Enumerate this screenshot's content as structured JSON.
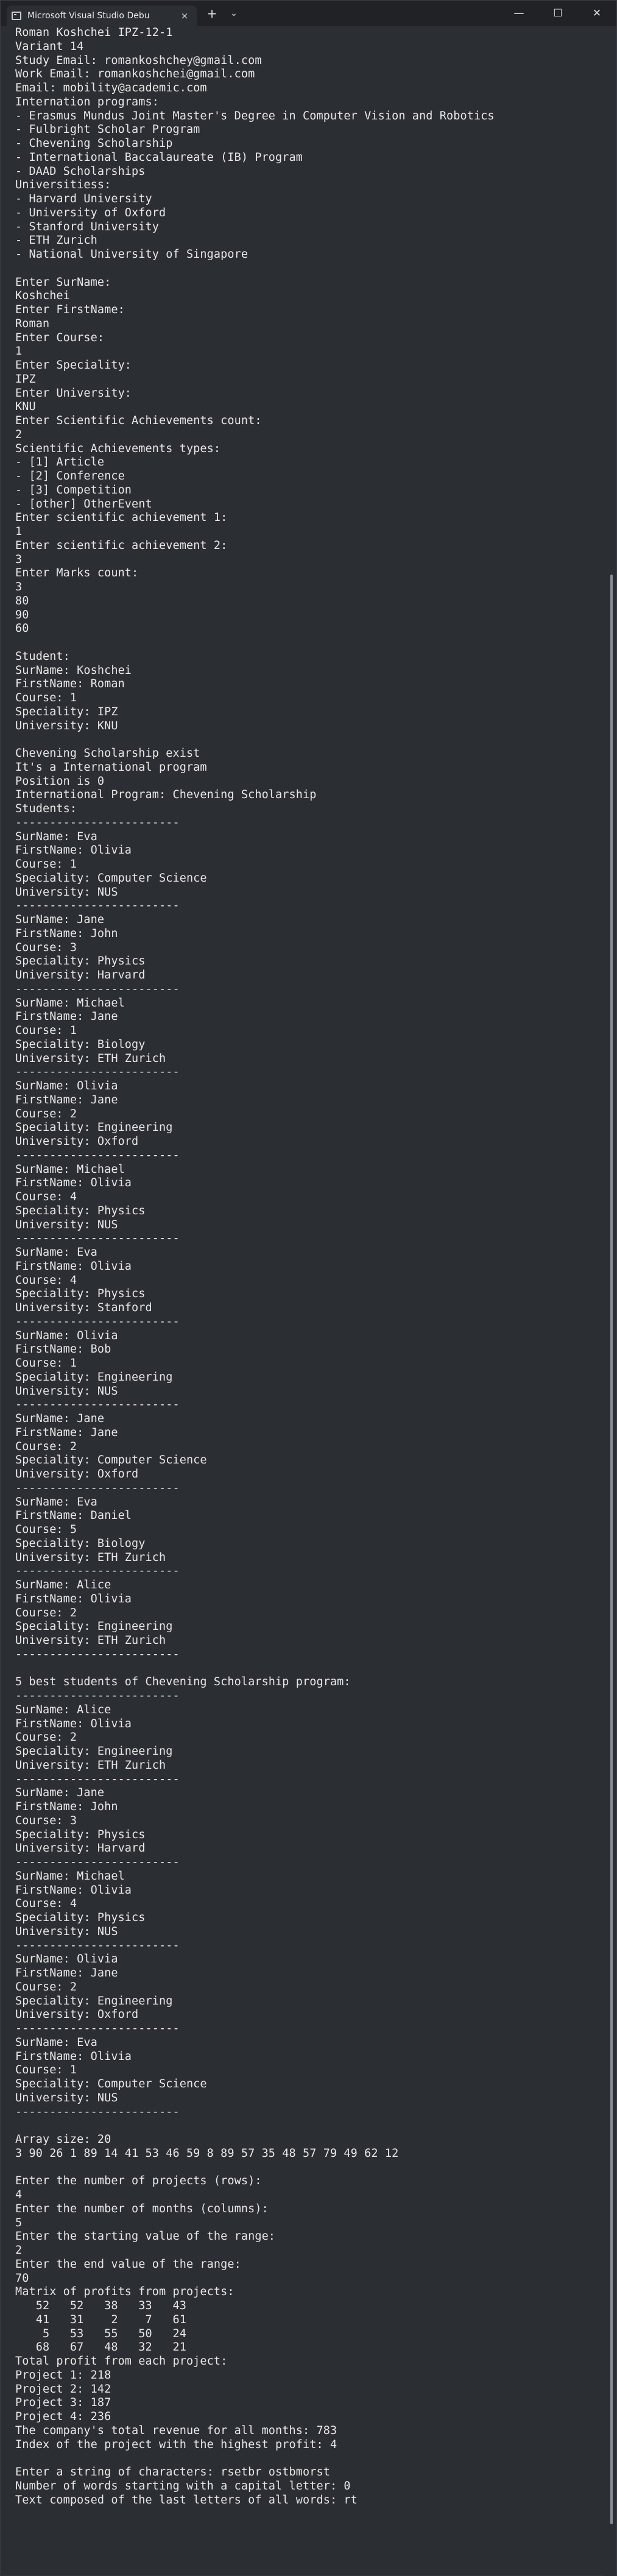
{
  "window": {
    "tab_title": "Microsoft Visual Studio Debu",
    "close_tab_glyph": "×",
    "new_tab_glyph": "+",
    "dropdown_glyph": "⌄",
    "minimize_glyph": "—",
    "maximize_glyph": "☐",
    "close_glyph": "✕"
  },
  "console_lines": [
    "Roman Koshchei IPZ-12-1",
    "Variant 14",
    "Study Email: romankoshchey@gmail.com",
    "Work Email: romankoshchei@gmail.com",
    "Email: mobility@academic.com",
    "Internation programs:",
    "- Erasmus Mundus Joint Master's Degree in Computer Vision and Robotics",
    "- Fulbright Scholar Program",
    "- Chevening Scholarship",
    "- International Baccalaureate (IB) Program",
    "- DAAD Scholarships",
    "Universitiess:",
    "- Harvard University",
    "- University of Oxford",
    "- Stanford University",
    "- ETH Zurich",
    "- National University of Singapore",
    "",
    "Enter SurName:",
    "Koshchei",
    "Enter FirstName:",
    "Roman",
    "Enter Course:",
    "1",
    "Enter Speciality:",
    "IPZ",
    "Enter University:",
    "KNU",
    "Enter Scientific Achievements count:",
    "2",
    "Scientific Achievements types:",
    "- [1] Article",
    "- [2] Conference",
    "- [3] Competition",
    "- [other] OtherEvent",
    "Enter scientific achievement 1:",
    "1",
    "Enter scientific achievement 2:",
    "3",
    "Enter Marks count:",
    "3",
    "80",
    "90",
    "60",
    "",
    "Student:",
    "SurName: Koshchei",
    "FirstName: Roman",
    "Course: 1",
    "Speciality: IPZ",
    "University: KNU",
    "",
    "Chevening Scholarship exist",
    "It's a International program",
    "Position is 0",
    "International Program: Chevening Scholarship",
    "Students:",
    "------------------------",
    "SurName: Eva",
    "FirstName: Olivia",
    "Course: 1",
    "Speciality: Computer Science",
    "University: NUS",
    "------------------------",
    "SurName: Jane",
    "FirstName: John",
    "Course: 3",
    "Speciality: Physics",
    "University: Harvard",
    "------------------------",
    "SurName: Michael",
    "FirstName: Jane",
    "Course: 1",
    "Speciality: Biology",
    "University: ETH Zurich",
    "------------------------",
    "SurName: Olivia",
    "FirstName: Jane",
    "Course: 2",
    "Speciality: Engineering",
    "University: Oxford",
    "------------------------",
    "SurName: Michael",
    "FirstName: Olivia",
    "Course: 4",
    "Speciality: Physics",
    "University: NUS",
    "------------------------",
    "SurName: Eva",
    "FirstName: Olivia",
    "Course: 4",
    "Speciality: Physics",
    "University: Stanford",
    "------------------------",
    "SurName: Olivia",
    "FirstName: Bob",
    "Course: 1",
    "Speciality: Engineering",
    "University: NUS",
    "------------------------",
    "SurName: Jane",
    "FirstName: Jane",
    "Course: 2",
    "Speciality: Computer Science",
    "University: Oxford",
    "------------------------",
    "SurName: Eva",
    "FirstName: Daniel",
    "Course: 5",
    "Speciality: Biology",
    "University: ETH Zurich",
    "------------------------",
    "SurName: Alice",
    "FirstName: Olivia",
    "Course: 2",
    "Speciality: Engineering",
    "University: ETH Zurich",
    "------------------------",
    "",
    "5 best students of Chevening Scholarship program:",
    "------------------------",
    "SurName: Alice",
    "FirstName: Olivia",
    "Course: 2",
    "Speciality: Engineering",
    "University: ETH Zurich",
    "------------------------",
    "SurName: Jane",
    "FirstName: John",
    "Course: 3",
    "Speciality: Physics",
    "University: Harvard",
    "------------------------",
    "SurName: Michael",
    "FirstName: Olivia",
    "Course: 4",
    "Speciality: Physics",
    "University: NUS",
    "------------------------",
    "SurName: Olivia",
    "FirstName: Jane",
    "Course: 2",
    "Speciality: Engineering",
    "University: Oxford",
    "------------------------",
    "SurName: Eva",
    "FirstName: Olivia",
    "Course: 1",
    "Speciality: Computer Science",
    "University: NUS",
    "------------------------",
    "",
    "Array size: 20",
    "3 90 26 1 89 14 41 53 46 59 8 89 57 35 48 57 79 49 62 12",
    "",
    "Enter the number of projects (rows):",
    "4",
    "Enter the number of months (columns):",
    "5",
    "Enter the starting value of the range:",
    "2",
    "Enter the end value of the range:",
    "70",
    "Matrix of profits from projects:",
    "   52   52   38   33   43",
    "   41   31    2    7   61",
    "    5   53   55   50   24",
    "   68   67   48   32   21",
    "Total profit from each project:",
    "Project 1: 218",
    "Project 2: 142",
    "Project 3: 187",
    "Project 4: 236",
    "The company's total revenue for all months: 783",
    "Index of the project with the highest profit: 4",
    "",
    "Enter a string of characters: rsetbr ostbmorst",
    "Number of words starting with a capital letter: 0",
    "Text composed of the last letters of all words: rt"
  ]
}
